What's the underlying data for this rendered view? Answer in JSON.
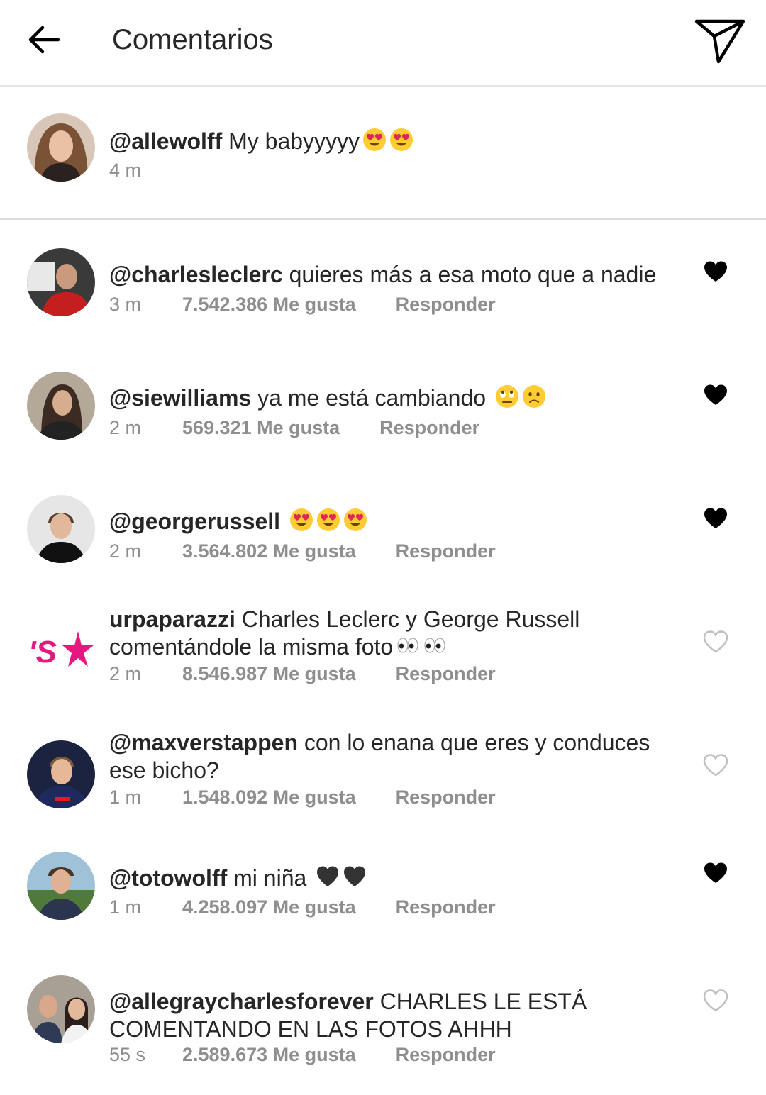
{
  "header": {
    "title": "Comentarios"
  },
  "caption": {
    "user": "@allewolff",
    "text": " My babyyyyy",
    "emojis": [
      "heart-eyes",
      "heart-eyes"
    ],
    "time": "4 m"
  },
  "comments": [
    {
      "user": "@charlesleclerc",
      "text": " quieres más a esa moto que a nadie",
      "emojis": [],
      "time": "3 m",
      "likes": "7.542.386 Me gusta",
      "reply": "Responder",
      "liked": true
    },
    {
      "user": "@siewilliams",
      "text": " ya me está cambiando ",
      "emojis": [
        "eye-roll",
        "frown"
      ],
      "time": "2 m",
      "likes": "569.321 Me gusta",
      "reply": "Responder",
      "liked": true
    },
    {
      "user": "@georgerussell",
      "text": " ",
      "emojis": [
        "heart-eyes",
        "heart-eyes",
        "heart-eyes"
      ],
      "time": "2 m",
      "likes": "3.564.802 Me gusta",
      "reply": "Responder",
      "liked": true
    },
    {
      "user": "urpaparazzi",
      "text": " Charles Leclerc y George Russell comentándole la misma foto",
      "emojis": [
        "eyes",
        "eyes"
      ],
      "time": "2 m",
      "likes": "8.546.987 Me gusta",
      "reply": "Responder",
      "liked": false
    },
    {
      "user": "@maxverstappen",
      "text": " con lo enana que eres y conduces ese bicho?",
      "emojis": [],
      "time": "1 m",
      "likes": "1.548.092 Me gusta",
      "reply": "Responder",
      "liked": false
    },
    {
      "user": "@totowolff",
      "text": " mi niña ",
      "emojis": [
        "black-heart",
        "black-heart"
      ],
      "time": "1 m",
      "likes": "4.258.097 Me gusta",
      "reply": "Responder",
      "liked": true
    },
    {
      "user": "@allegraycharlesforever",
      "text": " CHARLES LE ESTÁ COMENTANDO EN LAS FOTOS AHHH",
      "emojis": [],
      "time": "55 s",
      "likes": "2.589.673 Me gusta",
      "reply": "Responder",
      "liked": false
    }
  ],
  "colors": {
    "text": "#262626",
    "meta": "#8e8e8e",
    "heart_liked": "#000000",
    "heart_outline": "#bfbfbf",
    "divider": "#dbdbdb"
  }
}
